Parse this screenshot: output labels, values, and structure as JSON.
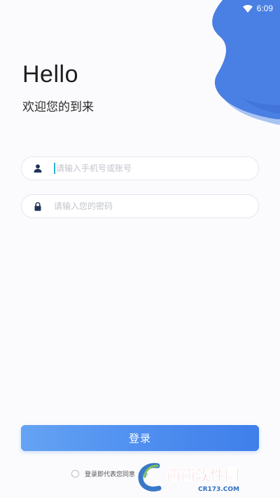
{
  "status_bar": {
    "time": "6:09",
    "wifi_icon": "wifi-icon"
  },
  "colors": {
    "accent": "#4f8ff0",
    "wave_dark": "#4a7fe3",
    "wave_light": "#8ab0f0",
    "background": "#fbfbfe"
  },
  "header": {
    "title": "Hello",
    "subtitle": "欢迎您的到来"
  },
  "form": {
    "phone": {
      "icon": "user-icon",
      "placeholder": "请输入手机号或账号",
      "value": ""
    },
    "password": {
      "icon": "lock-icon",
      "placeholder": "请输入您的密码",
      "value": ""
    },
    "login_label": "登录"
  },
  "agreement": {
    "text": "登录即代表您同意",
    "link": "《协"
  },
  "watermark": {
    "brand": "西西软件园",
    "site": "CR173.COM"
  }
}
